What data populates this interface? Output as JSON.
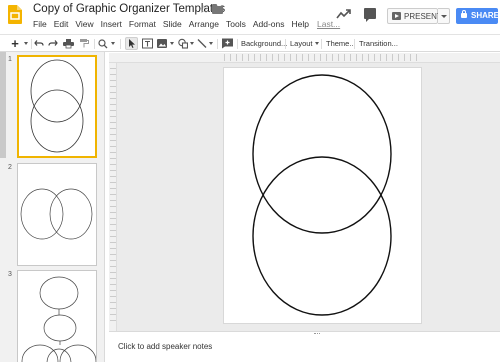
{
  "header": {
    "title": "Copy of Graphic Organizer Templates",
    "star_glyph": "☆",
    "icons": [
      "slides-logo-icon",
      "star-icon",
      "folder-icon",
      "activity-trend-icon",
      "comments-icon"
    ],
    "present_label": "PRESENT",
    "share_label": "SHARE",
    "accent_color": "#4a8af4",
    "logo_color": "#f4b400"
  },
  "menu": {
    "items": [
      "File",
      "Edit",
      "View",
      "Insert",
      "Format",
      "Slide",
      "Arrange",
      "Tools",
      "Add-ons",
      "Help"
    ],
    "last_edit": "Last..."
  },
  "toolbar": {
    "plus_glyph": "+",
    "zoom_glyph": "🔍",
    "background_label": "Background...",
    "layout_label": "Layout",
    "theme_label": "Theme...",
    "transition_label": "Transition...",
    "icons": [
      "new-slide-icon",
      "undo-icon",
      "redo-icon",
      "print-icon",
      "paint-format-icon",
      "zoom-icon",
      "select-cursor-icon",
      "text-box-icon",
      "image-icon",
      "shape-icon",
      "line-icon",
      "comment-add-icon"
    ]
  },
  "filmstrip": {
    "slides": [
      {
        "number": "1",
        "layout": "venn-vertical",
        "selected": true
      },
      {
        "number": "2",
        "layout": "venn-horizontal",
        "selected": false
      },
      {
        "number": "3",
        "layout": "circle-tree",
        "selected": false
      }
    ]
  },
  "canvas": {
    "layout": "venn-vertical"
  },
  "notes": {
    "placeholder": "Click to add speaker notes"
  }
}
